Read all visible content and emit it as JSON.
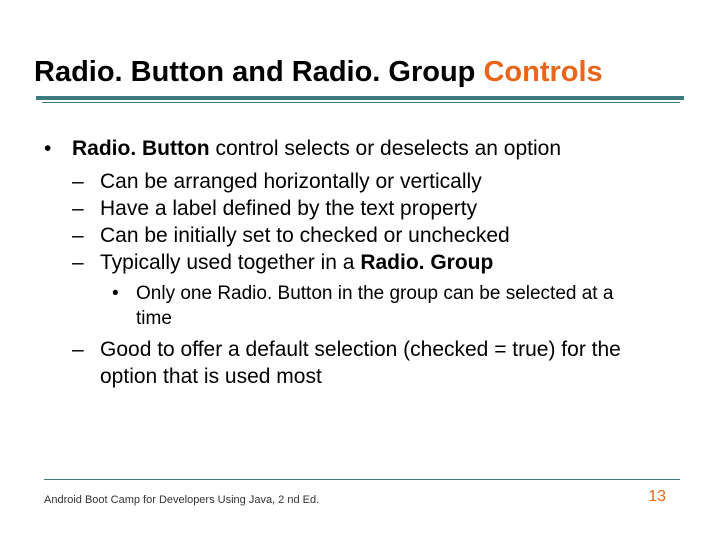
{
  "title": {
    "part1": "Radio. Button and Radio. Group ",
    "part2": "Controls"
  },
  "bullets": {
    "b1_prefix_bold": "Radio. Button",
    "b1_rest": " control selects or deselects an option",
    "d1": "Can be arranged horizontally or vertically",
    "d2": "Have a label defined by the text property",
    "d3": "Can be initially set to checked or unchecked",
    "d4_prefix": "Typically used together in a ",
    "d4_bold": "Radio. Group",
    "sb1": "Only one Radio. Button in the group can be selected at a time",
    "d5": "Good to offer a default selection (checked = true) for the option that is used most"
  },
  "footer": "Android Boot Camp for Developers Using Java, 2 nd Ed.",
  "page": "13"
}
